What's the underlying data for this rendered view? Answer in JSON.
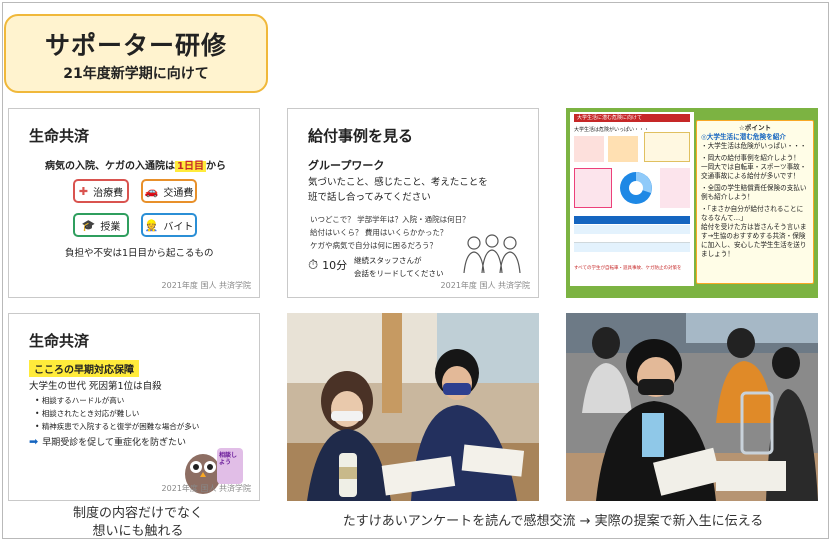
{
  "header": {
    "title": "サポーター研修",
    "subtitle": "21年度新学期に向けて"
  },
  "slide1": {
    "heading": "生命共済",
    "lead_prefix": "病気の入院、ケガの入通院は",
    "lead_highlight": "1日目",
    "lead_suffix": "から",
    "buttons": [
      {
        "icon": "hospital-icon",
        "label": "治療費",
        "color": "#d9534f"
      },
      {
        "icon": "car-icon",
        "label": "交通費",
        "color": "#e8902a"
      },
      {
        "icon": "graduation-cap-icon",
        "label": "授業",
        "color": "#2f9e5e"
      },
      {
        "icon": "worker-icon",
        "label": "バイト",
        "color": "#2b8fd6"
      }
    ],
    "footer": "負担や不安は1日目から起こるもの",
    "copyright": "2021年度 国人 共済学院"
  },
  "slide2": {
    "heading": "給付事例を見る",
    "subheading": "グループワーク",
    "intro_line1": "気づいたこと、感じたこと、考えたことを",
    "intro_line2": "班で話し合ってみてください",
    "questions": [
      "いつどこで？ 学部学年は？入院・通院は何日？",
      "給付はいくら？ 費用はいくらかかった？",
      "ケガや病気で自分は何に困るだろう？"
    ],
    "timer": "10分",
    "note_line1": "継続スタッフさんが",
    "note_line2": "会話をリードしてください",
    "copyright": "2021年度 国人 共済学院"
  },
  "slide3": {
    "doc_title": "大学生活に潜む危険に向けて",
    "left_heading": "大学生活は危険がいっぱい・・・",
    "left_items": [
      "ポイント",
      "ケガ",
      "病気"
    ],
    "table_note": "すべての学生が自転車・遊具事故、ケガ防止の対策を",
    "panel_title": "☆ポイント",
    "panel_lines": [
      "◎大学生活に潜む危険を紹介",
      "・大学生活は危険がいっぱい・・・",
      "・岡大の給付事例を紹介しよう！",
      "一岡大では自転車・スポーツ事故・交通事故による給付が多いです！",
      "・全国の学生賠償責任保険の支払い例も紹介しよう！",
      "・「まさか自分が給付されることになるなんて…」",
      "給付を受けた方は皆さんそう言います→生協のおすすめする共済・保険に加入し、安心した学生生活を送りましょう！"
    ]
  },
  "slide4": {
    "heading": "生命共済",
    "banner": "こころの早期対応保障",
    "lead": "大学生の世代 死因第1位は自殺",
    "bullets": [
      "相談するハードルが高い",
      "相談されたとき対応が難しい",
      "精神疾患で入院すると復学が困難な場合が多い"
    ],
    "arrow_item": "早期受診を促して重症化を防ぎたい",
    "mascot_text": "相談しよう",
    "copyright": "2021年度 国人 共済学院"
  },
  "captions": {
    "left_line1": "制度の内容だけでなく",
    "left_line2": "想いにも触れる",
    "right": "たすけあいアンケートを読んで感想交流 → 実際の提案で新入生に伝える"
  }
}
